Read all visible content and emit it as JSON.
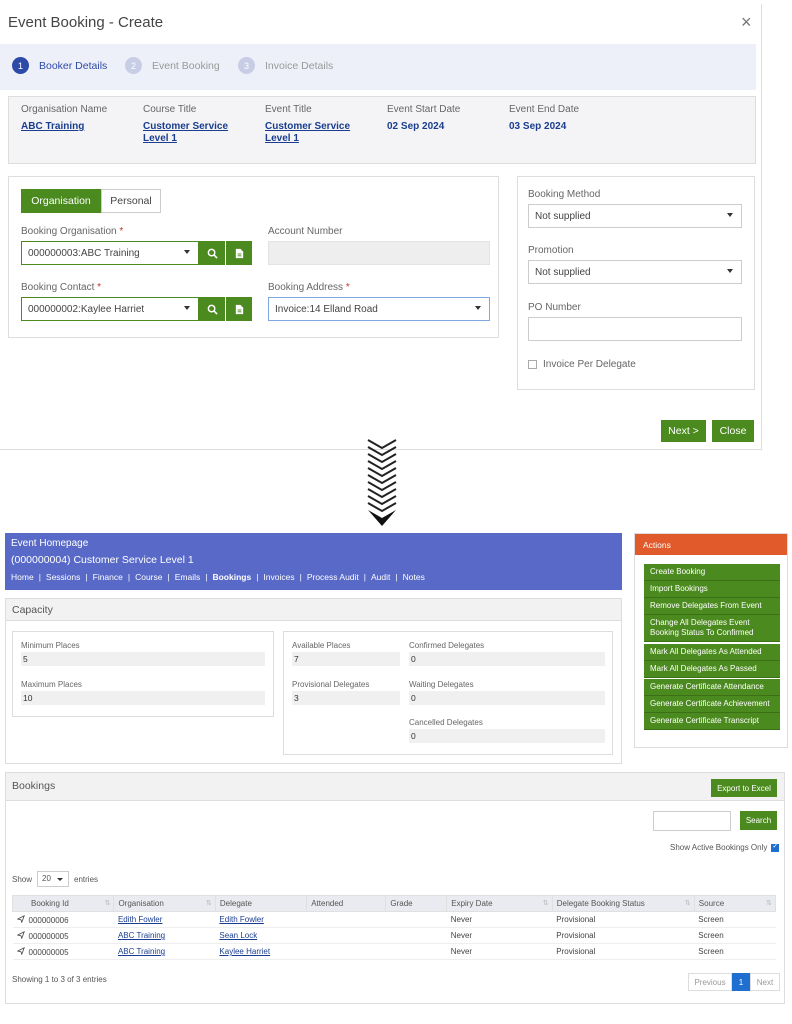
{
  "dialog": {
    "title": "Event Booking - Create",
    "close_icon": "×",
    "steps": [
      {
        "num": "1",
        "label": "Booker Details"
      },
      {
        "num": "2",
        "label": "Event Booking"
      },
      {
        "num": "3",
        "label": "Invoice Details"
      }
    ],
    "summary": {
      "org_label": "Organisation Name",
      "org_value": "ABC Training",
      "course_label": "Course Title",
      "course_value": "Customer Service Level 1",
      "event_label": "Event Title",
      "event_value": "Customer Service Level 1",
      "start_label": "Event Start Date",
      "start_value": "02 Sep 2024",
      "end_label": "Event End Date",
      "end_value": "03 Sep 2024"
    },
    "toggle": {
      "organisation": "Organisation",
      "personal": "Personal"
    },
    "booking_org": {
      "label": "Booking Organisation",
      "required": "*",
      "value": "000000003:ABC Training"
    },
    "account_number": {
      "label": "Account Number"
    },
    "booking_contact": {
      "label": "Booking Contact",
      "required": "*",
      "value": "000000002:Kaylee Harriet"
    },
    "booking_address": {
      "label": "Booking Address",
      "required": "*",
      "value": "Invoice:14 Elland Road"
    },
    "booking_method": {
      "label": "Booking Method",
      "value": "Not supplied"
    },
    "promotion": {
      "label": "Promotion",
      "value": "Not supplied"
    },
    "po_number": {
      "label": "PO Number",
      "value": ""
    },
    "invoice_per_delegate": "Invoice Per Delegate",
    "next_label": "Next >",
    "close_label": "Close"
  },
  "event": {
    "title": "Event Homepage",
    "subtitle": "(000000004) Customer Service Level 1",
    "nav": [
      "Home",
      "Sessions",
      "Finance",
      "Course",
      "Emails",
      "Bookings",
      "Invoices",
      "Process Audit",
      "Audit",
      "Notes"
    ],
    "nav_separator": "|"
  },
  "actions": {
    "header": "Actions",
    "items": [
      "Create Booking",
      "Import Bookings",
      "Remove Delegates From Event",
      "Change All Delegates Event Booking Status To Confirmed",
      "Mark All Delegates As Attended",
      "Mark All Delegates As Passed",
      "Generate Certificate Attendance",
      "Generate Certificate Achievement",
      "Generate Certificate Transcript"
    ]
  },
  "capacity": {
    "header": "Capacity",
    "min_label": "Minimum Places",
    "min_value": "5",
    "max_label": "Maximum Places",
    "max_value": "10",
    "avail_label": "Available Places",
    "avail_value": "7",
    "confirmed_label": "Confirmed Delegates",
    "confirmed_value": "0",
    "provisional_label": "Provisional Delegates",
    "provisional_value": "3",
    "waiting_label": "Waiting Delegates",
    "waiting_value": "0",
    "cancelled_label": "Cancelled Delegates",
    "cancelled_value": "0"
  },
  "bookings": {
    "header": "Bookings",
    "export_label": "Export to Excel",
    "search_label": "Search",
    "show_active_label": "Show Active Bookings Only",
    "show_label": "Show",
    "entries_value": "20",
    "entries_label": "entries",
    "columns": [
      "Booking Id",
      "Organisation",
      "Delegate",
      "Attended",
      "Grade",
      "Expiry Date",
      "Delegate Booking Status",
      "Source"
    ],
    "rows": [
      {
        "id": "000000006",
        "org": "Edith Fowler",
        "delegate": "Edith Fowler",
        "attended": "",
        "grade": "",
        "expiry": "Never",
        "status": "Provisional",
        "source": "Screen"
      },
      {
        "id": "000000005",
        "org": "ABC Training",
        "delegate": "Sean Lock",
        "attended": "",
        "grade": "",
        "expiry": "Never",
        "status": "Provisional",
        "source": "Screen"
      },
      {
        "id": "000000005",
        "org": "ABC Training",
        "delegate": "Kaylee Harriet",
        "attended": "",
        "grade": "",
        "expiry": "Never",
        "status": "Provisional",
        "source": "Screen"
      }
    ],
    "showing_text": "Showing 1 to 3 of 3 entries",
    "pager": {
      "previous": "Previous",
      "page": "1",
      "next": "Next"
    }
  },
  "colors": {
    "primary_green": "#4b8a1e",
    "header_blue": "#5869c8",
    "actions_orange": "#e05a2b",
    "link_blue": "#1a3d8f"
  }
}
